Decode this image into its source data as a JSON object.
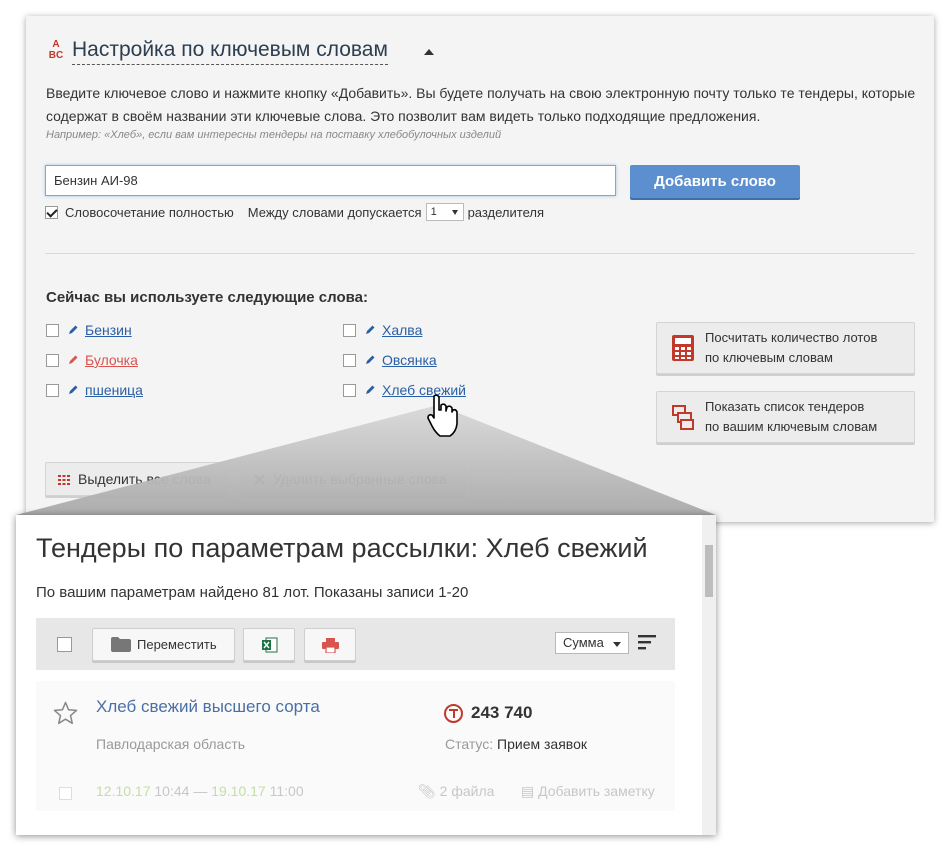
{
  "settings": {
    "abc_icon": "abc-icon",
    "title": "Настройка по ключевым словам",
    "intro": "Введите ключевое слово и нажмите кнопку «Добавить». Вы будете получать на свою электронную почту только те тендеры, которые содержат в своём названии эти ключевые слова. Это позволит вам видеть только подходящие предложения.",
    "example": "Например: «Хлеб», если вам интересны тендеры на поставку хлебобулочных изделий",
    "input_value": "Бензин АИ-98",
    "add_button": "Добавить слово",
    "full_phrase_label": "Словосочетание полностью",
    "full_phrase_checked": true,
    "separators_label_before": "Между словами допускается",
    "separators_value": "1",
    "separators_label_after": "разделителя"
  },
  "words_section": {
    "title": "Сейчас вы используете следующие слова:",
    "words": [
      {
        "label": "Бензин",
        "color": "#2a5fa7"
      },
      {
        "label": "Булочка",
        "color": "#d9534f"
      },
      {
        "label": "пшеница",
        "color": "#2a5fa7"
      },
      {
        "label": "Халва",
        "color": "#2a5fa7"
      },
      {
        "label": "Овсянка",
        "color": "#2a5fa7"
      },
      {
        "label": "Хлеб свежий",
        "color": "#2a5fa7"
      }
    ]
  },
  "side_buttons": {
    "count_line1": "Посчитать количество лотов",
    "count_line2": "по ключевым словам",
    "list_line1": "Показать список тендеров",
    "list_line2": "по вашим ключевым словам"
  },
  "bottom_buttons": {
    "select_all": "Выделить все слова",
    "delete_selected": "Удалить выбранные слова"
  },
  "popup": {
    "title": "Тендеры по параметрам рассылки: Хлеб свежий",
    "summary": "По вашим параметрам найдено 81 лот. Показаны записи 1-20",
    "toolbar": {
      "move": "Переместить",
      "sort": "Сумма"
    },
    "tender": {
      "title": "Хлеб свежий высшего сорта",
      "region": "Павлодарская область",
      "price": "243 740",
      "status_label": "Статус:",
      "status_value": "Прием заявок",
      "date_from": "12.10.17",
      "time_from": "10:44 —",
      "date_to": "19.10.17",
      "time_to": "11:00",
      "files": "2 файла",
      "note": "Добавить заметку"
    }
  },
  "colors": {
    "accent_blue": "#5b8fcf",
    "red": "#c0392b",
    "link": "#2a5fa7"
  }
}
